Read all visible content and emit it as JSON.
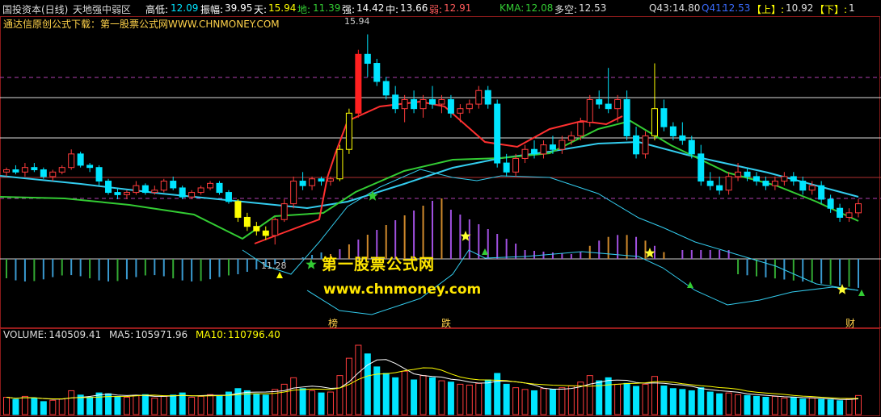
{
  "header": {
    "stock_name": "国投资本(日线)",
    "indicator_name": "天地强中弱区",
    "high_low_label": "高低:",
    "high_low_value": "12.09",
    "amplitude_label": "振幅:",
    "amplitude_value": "39.95",
    "tian_label": "天:",
    "tian_value": "15.94",
    "di_label": "地:",
    "di_value": "11.39",
    "qiang_label": "强:",
    "qiang_value": "14.42",
    "zhong_label": "中:",
    "zhong_value": "13.66",
    "ruo_label": "弱:",
    "ruo_value": "12.91",
    "kma_label": "KMA:",
    "kma_value": "12.08",
    "duokong_label": "多空:",
    "duokong_value": "12.53",
    "q43_label": "Q43:",
    "q43_value": "14.80",
    "q41_label": "Q41:",
    "q41_value": "12.53",
    "up_label": "【上】:",
    "up_value": "10.92",
    "down_label": "【下】:",
    "down_value": "1"
  },
  "subtitle": "通达信原创公式下载：第一股票公式网WWW.CHNMONEY.COM",
  "peak_label": "15.94",
  "low_label": "11.28",
  "watermark": {
    "cn": "第一股票公式网",
    "url": "www.chnmoney.com"
  },
  "markers": {
    "bang": "榜",
    "die": "跌",
    "cai": "财"
  },
  "volume": {
    "vol_label": "VOLUME:",
    "vol_value": "140509.41",
    "ma5_label": "MA5:",
    "ma5_value": "105971.96",
    "ma10_label": "MA10:",
    "ma10_value": "110796.40"
  },
  "colors": {
    "bg": "#000000",
    "up": "#ff3c3c",
    "down": "#00e5ff",
    "yellow": "#ffff00",
    "green": "#33cc33",
    "cyan_line": "#00bfff",
    "magenta": "#cc33cc",
    "orange": "#d08a2c"
  },
  "chart_data": {
    "type": "candlestick",
    "price_range": [
      11.0,
      16.2
    ],
    "candles": [
      [
        12.9,
        13.0,
        12.8,
        12.95
      ],
      [
        12.95,
        13.05,
        12.85,
        12.9
      ],
      [
        12.9,
        13.1,
        12.8,
        13.0
      ],
      [
        13.0,
        13.1,
        12.9,
        12.95
      ],
      [
        12.95,
        13.0,
        12.75,
        12.8
      ],
      [
        12.8,
        12.95,
        12.7,
        12.9
      ],
      [
        12.9,
        13.05,
        12.85,
        13.0
      ],
      [
        13.0,
        13.4,
        12.95,
        13.3
      ],
      [
        13.3,
        13.35,
        13.0,
        13.05
      ],
      [
        13.05,
        13.1,
        12.9,
        13.0
      ],
      [
        13.0,
        13.05,
        12.6,
        12.7
      ],
      [
        12.7,
        12.75,
        12.4,
        12.45
      ],
      [
        12.45,
        12.55,
        12.3,
        12.4
      ],
      [
        12.4,
        12.5,
        12.3,
        12.45
      ],
      [
        12.45,
        12.7,
        12.4,
        12.6
      ],
      [
        12.6,
        12.65,
        12.4,
        12.45
      ],
      [
        12.45,
        12.6,
        12.4,
        12.5
      ],
      [
        12.5,
        12.75,
        12.45,
        12.7
      ],
      [
        12.7,
        12.8,
        12.5,
        12.55
      ],
      [
        12.55,
        12.6,
        12.3,
        12.35
      ],
      [
        12.35,
        12.5,
        12.3,
        12.45
      ],
      [
        12.45,
        12.6,
        12.4,
        12.55
      ],
      [
        12.55,
        12.7,
        12.5,
        12.65
      ],
      [
        12.65,
        12.7,
        12.4,
        12.45
      ],
      [
        12.45,
        12.5,
        12.2,
        12.25
      ],
      [
        12.25,
        12.3,
        11.8,
        11.9
      ],
      [
        11.9,
        12.0,
        11.6,
        11.7
      ],
      [
        11.7,
        11.8,
        11.5,
        11.6
      ],
      [
        11.6,
        11.7,
        11.4,
        11.5
      ],
      [
        11.5,
        11.9,
        11.3,
        11.85
      ],
      [
        11.85,
        12.3,
        11.8,
        12.2
      ],
      [
        12.2,
        12.8,
        12.1,
        12.7
      ],
      [
        12.7,
        12.9,
        12.5,
        12.6
      ],
      [
        12.6,
        12.8,
        12.5,
        12.75
      ],
      [
        12.75,
        12.8,
        12.6,
        12.7
      ],
      [
        12.7,
        12.8,
        12.6,
        12.75
      ],
      [
        12.75,
        13.5,
        12.7,
        13.4
      ],
      [
        13.4,
        14.3,
        13.3,
        14.2
      ],
      [
        14.2,
        15.6,
        14.1,
        15.5
      ],
      [
        15.5,
        15.94,
        15.0,
        15.3
      ],
      [
        15.3,
        15.4,
        14.8,
        14.9
      ],
      [
        14.9,
        15.0,
        14.5,
        14.6
      ],
      [
        14.6,
        14.8,
        14.2,
        14.3
      ],
      [
        14.3,
        14.6,
        14.0,
        14.5
      ],
      [
        14.5,
        14.7,
        14.2,
        14.3
      ],
      [
        14.3,
        14.6,
        14.1,
        14.5
      ],
      [
        14.5,
        14.8,
        14.3,
        14.4
      ],
      [
        14.4,
        14.6,
        14.2,
        14.5
      ],
      [
        14.5,
        14.6,
        14.1,
        14.2
      ],
      [
        14.2,
        14.4,
        14.0,
        14.3
      ],
      [
        14.3,
        14.5,
        14.2,
        14.4
      ],
      [
        14.4,
        14.8,
        14.3,
        14.7
      ],
      [
        14.7,
        14.8,
        14.3,
        14.4
      ],
      [
        14.4,
        14.5,
        13.0,
        13.1
      ],
      [
        13.1,
        13.3,
        12.8,
        12.9
      ],
      [
        12.9,
        13.3,
        12.8,
        13.2
      ],
      [
        13.2,
        13.5,
        13.1,
        13.4
      ],
      [
        13.4,
        13.6,
        13.2,
        13.3
      ],
      [
        13.3,
        13.6,
        13.2,
        13.5
      ],
      [
        13.5,
        13.7,
        13.3,
        13.4
      ],
      [
        13.4,
        13.7,
        13.3,
        13.6
      ],
      [
        13.6,
        13.8,
        13.5,
        13.7
      ],
      [
        13.7,
        14.1,
        13.6,
        14.0
      ],
      [
        14.0,
        14.6,
        13.9,
        14.5
      ],
      [
        14.5,
        14.7,
        14.3,
        14.4
      ],
      [
        14.4,
        15.2,
        14.2,
        14.3
      ],
      [
        14.3,
        14.6,
        14.0,
        14.5
      ],
      [
        14.5,
        14.7,
        13.6,
        13.7
      ],
      [
        13.7,
        13.9,
        13.2,
        13.3
      ],
      [
        13.3,
        13.8,
        13.2,
        13.7
      ],
      [
        13.7,
        15.3,
        13.6,
        14.3
      ],
      [
        14.3,
        14.5,
        13.8,
        13.9
      ],
      [
        13.9,
        14.0,
        13.6,
        13.7
      ],
      [
        13.7,
        14.0,
        13.5,
        13.6
      ],
      [
        13.6,
        13.7,
        13.2,
        13.3
      ],
      [
        13.3,
        13.5,
        12.6,
        12.7
      ],
      [
        12.7,
        12.9,
        12.5,
        12.6
      ],
      [
        12.6,
        12.8,
        12.4,
        12.5
      ],
      [
        12.5,
        12.9,
        12.4,
        12.8
      ],
      [
        12.8,
        13.1,
        12.7,
        12.9
      ],
      [
        12.9,
        13.0,
        12.7,
        12.8
      ],
      [
        12.8,
        12.9,
        12.6,
        12.7
      ],
      [
        12.7,
        12.8,
        12.5,
        12.6
      ],
      [
        12.6,
        12.8,
        12.5,
        12.7
      ],
      [
        12.7,
        12.9,
        12.6,
        12.8
      ],
      [
        12.8,
        12.9,
        12.6,
        12.7
      ],
      [
        12.7,
        12.8,
        12.4,
        12.5
      ],
      [
        12.5,
        12.7,
        12.4,
        12.6
      ],
      [
        12.6,
        12.7,
        12.2,
        12.3
      ],
      [
        12.3,
        12.4,
        12.0,
        12.1
      ],
      [
        12.1,
        12.2,
        11.8,
        11.9
      ],
      [
        11.9,
        12.1,
        11.8,
        12.0
      ],
      [
        12.0,
        12.3,
        11.9,
        12.2
      ]
    ],
    "volume": [
      40,
      35,
      42,
      38,
      30,
      33,
      36,
      55,
      45,
      40,
      50,
      48,
      42,
      40,
      44,
      46,
      38,
      42,
      45,
      50,
      40,
      42,
      46,
      44,
      52,
      60,
      55,
      48,
      45,
      58,
      70,
      85,
      60,
      55,
      50,
      52,
      90,
      130,
      160,
      140,
      110,
      95,
      85,
      100,
      80,
      90,
      85,
      78,
      75,
      70,
      68,
      72,
      80,
      95,
      70,
      62,
      58,
      55,
      60,
      58,
      62,
      66,
      75,
      90,
      78,
      85,
      70,
      72,
      65,
      70,
      88,
      66,
      60,
      58,
      55,
      62,
      52,
      48,
      50,
      46,
      44,
      42,
      40,
      42,
      38,
      40,
      36,
      38,
      35,
      34,
      32,
      36,
      44
    ]
  }
}
